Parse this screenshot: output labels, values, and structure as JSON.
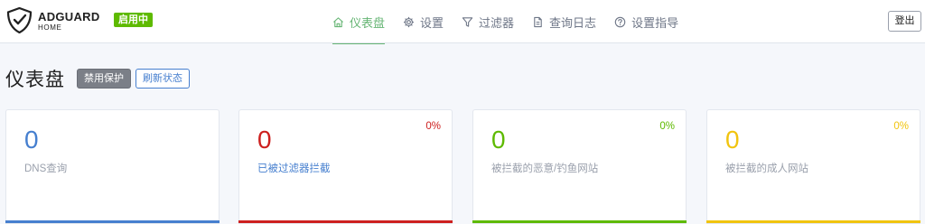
{
  "header": {
    "brand_name": "ADGUARD",
    "brand_sub": "HOME",
    "status_badge": "启用中",
    "nav": [
      {
        "label": "仪表盘",
        "icon": "home-icon"
      },
      {
        "label": "设置",
        "icon": "gear-icon"
      },
      {
        "label": "过滤器",
        "icon": "filter-icon"
      },
      {
        "label": "查询日志",
        "icon": "document-icon"
      },
      {
        "label": "设置指导",
        "icon": "help-icon"
      }
    ],
    "logout_label": "登出"
  },
  "page": {
    "title": "仪表盘",
    "disable_protection_label": "禁用保护",
    "refresh_label": "刷新状态"
  },
  "cards": [
    {
      "value": "0",
      "label": "DNS查询",
      "percent": "",
      "color": "#467fcf"
    },
    {
      "value": "0",
      "label": "已被过滤器拦截",
      "percent": "0%",
      "color": "#cd201f"
    },
    {
      "value": "0",
      "label": "被拦截的恶意/钓鱼网站",
      "percent": "0%",
      "color": "#5eba00"
    },
    {
      "value": "0",
      "label": "被拦截的成人网站",
      "percent": "0%",
      "color": "#f1c40f"
    }
  ],
  "colors": {
    "accent_green": "#66b574",
    "brand_green": "#5eba00",
    "blue": "#467fcf",
    "red": "#cd201f",
    "yellow": "#f1c40f"
  }
}
